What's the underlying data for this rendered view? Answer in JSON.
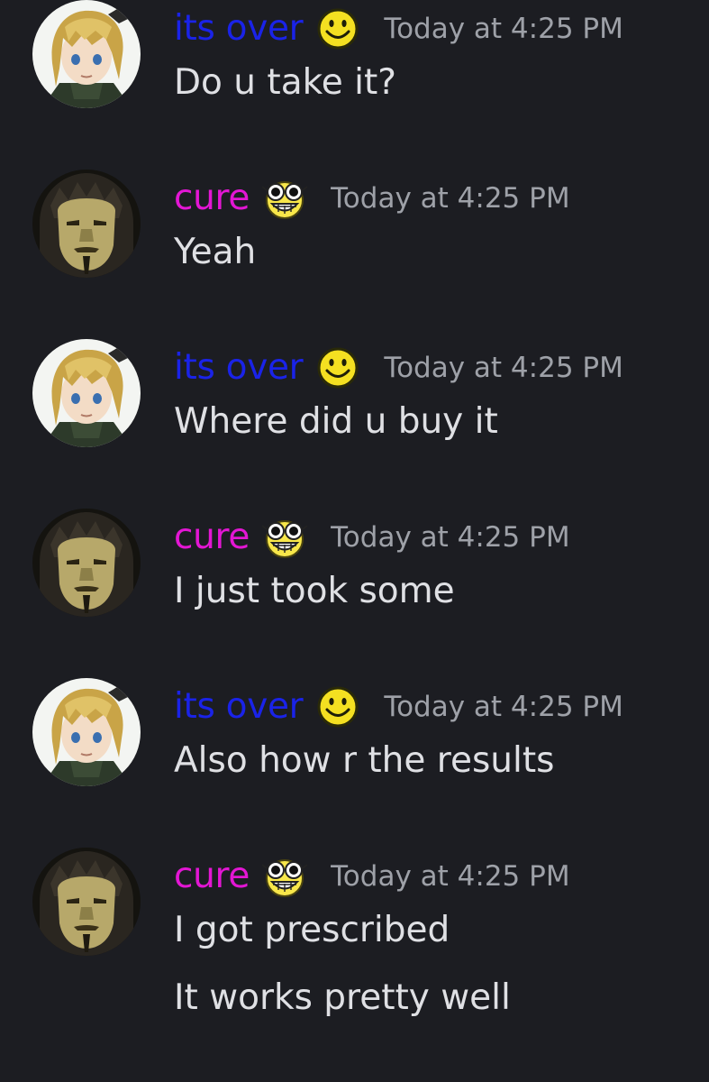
{
  "colors": {
    "background": "#1c1d22",
    "its_over_name": "#1a23e8",
    "cure_name": "#e316d4",
    "timestamp": "#9ea1a8",
    "message_text": "#dfe0e4"
  },
  "messages": [
    {
      "author": "its over",
      "author_key": "its_over",
      "badge_icon": "smiley-face-icon",
      "timestamp": "Today at 4:25 PM",
      "lines": [
        "Do u take it?"
      ]
    },
    {
      "author": "cure",
      "author_key": "cure",
      "badge_icon": "sunglasses-grin-icon",
      "timestamp": "Today at 4:25 PM",
      "lines": [
        "Yeah"
      ]
    },
    {
      "author": "its over",
      "author_key": "its_over",
      "badge_icon": "smiley-face-icon",
      "timestamp": "Today at 4:25 PM",
      "lines": [
        "Where did u buy it"
      ]
    },
    {
      "author": "cure",
      "author_key": "cure",
      "badge_icon": "sunglasses-grin-icon",
      "timestamp": "Today at 4:25 PM",
      "lines": [
        "I just took some"
      ]
    },
    {
      "author": "its over",
      "author_key": "its_over",
      "badge_icon": "smiley-face-icon",
      "timestamp": "Today at 4:25 PM",
      "lines": [
        "Also how r the results"
      ]
    },
    {
      "author": "cure",
      "author_key": "cure",
      "badge_icon": "sunglasses-grin-icon",
      "timestamp": "Today at 4:25 PM",
      "lines": [
        "I got prescribed",
        "It works pretty well"
      ]
    }
  ]
}
